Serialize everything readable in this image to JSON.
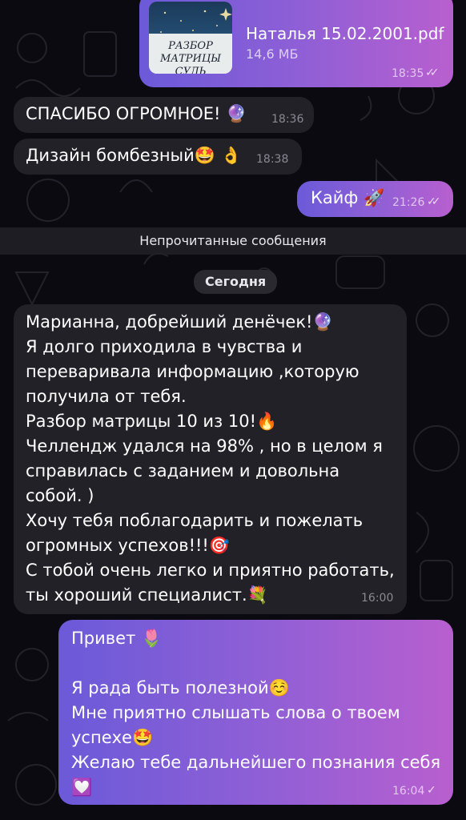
{
  "file_message": {
    "thumbnail_text": "РАЗБОР МАТРИЦЫ СУДЬ",
    "file_name": "Наталья 15.02.2001.pdf",
    "file_size": "14,6 МБ",
    "time": "18:35"
  },
  "incoming_1": {
    "text": "СПАСИБО ОГРОМНОЕ! 🔮",
    "time": "18:36"
  },
  "incoming_2": {
    "text": "Дизайн бомбезный🤩 👌",
    "time": "18:38"
  },
  "outgoing_1": {
    "text": "Кайф 🚀",
    "time": "21:26"
  },
  "unread_label": "Непрочитанные сообщения",
  "date_label": "Сегодня",
  "incoming_long": {
    "lines": [
      "Марианна, добрейший денёчек!🔮",
      "Я долго приходила в чувства и",
      "переваривала информацию ,которую",
      "получила от тебя.",
      "Разбор матрицы 10 из 10!🔥",
      "Челлендж удался на 98% , но в целом я",
      "справилась с заданием и довольна",
      "собой. )",
      "Хочу тебя поблагодарить и пожелать",
      "огромных успехов!!!🎯",
      "С тобой очень легко и приятно работать,",
      "ты хороший специалист.💐"
    ],
    "time": "16:00"
  },
  "outgoing_long": {
    "lines": [
      "Привет 🌷",
      "",
      "Я рада быть полезной☺️",
      "Мне приятно слышать слова о твоем",
      "успехе🤩",
      "Желаю тебе дальнейшего познания себя",
      "💟"
    ],
    "time": "16:04"
  }
}
